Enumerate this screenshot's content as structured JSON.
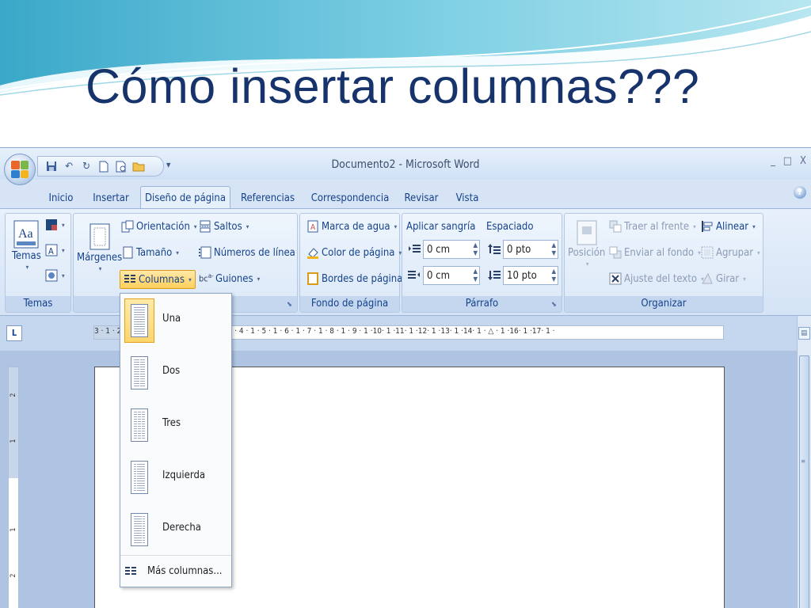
{
  "slide": {
    "title": "Cómo insertar columnas???"
  },
  "window": {
    "title": "Documento2 - Microsoft Word",
    "controls": [
      "_",
      "□",
      "X"
    ],
    "qat_icons": [
      "save-icon",
      "undo-icon",
      "redo-icon",
      "new-document-icon",
      "print-preview-icon",
      "open-icon"
    ]
  },
  "tabs": [
    "Inicio",
    "Insertar",
    "Diseño de página",
    "Referencias",
    "Correspondencia",
    "Revisar",
    "Vista"
  ],
  "active_tab": "Diseño de página",
  "ribbon": {
    "temas": {
      "label": "Temas",
      "button": "Temas"
    },
    "configurar": {
      "orientacion": "Orientación",
      "tamano": "Tamaño",
      "columnas": "Columnas",
      "margenes": "Márgenes",
      "saltos": "Saltos",
      "numeros": "Números de línea",
      "guiones": "Guiones"
    },
    "fondo": {
      "label": "Fondo de página",
      "marca": "Marca de agua",
      "color": "Color de página",
      "bordes": "Bordes de página"
    },
    "parrafo": {
      "label": "Párrafo",
      "sangria_title": "Aplicar sangría",
      "espaciado_title": "Espaciado",
      "sangria_izq": "0 cm",
      "sangria_der": "0 cm",
      "espacio_antes": "0 pto",
      "espacio_despues": "10 pto"
    },
    "organizar": {
      "label": "Organizar",
      "posicion": "Posición",
      "traer": "Traer al frente",
      "enviar": "Enviar al fondo",
      "ajuste": "Ajuste del texto",
      "alinear": "Alinear",
      "agrupar": "Agrupar",
      "girar": "Girar"
    }
  },
  "ruler": {
    "tab_selector": "L",
    "numbers": "3 · 1 · 2 · 1 · 1 · 1 · · · 1 · 1 · 2 · 1 · 3 · 1 · 4 · 1 · 5 · 1 · 6 · 1 · 7 · 1 · 8 · 1 · 9 · 1 ·10· 1 ·11· 1 ·12· 1 ·13· 1 ·14· 1 · △ · 1 ·16· 1 ·17· 1 ·",
    "vertical": [
      "2",
      "1",
      "1",
      "2"
    ]
  },
  "columns_menu": {
    "items": [
      "Una",
      "Dos",
      "Tres",
      "Izquierda",
      "Derecha"
    ],
    "selected": "Una",
    "more": "Más columnas..."
  },
  "colors": {
    "title": "#17336b",
    "ribbon_text": "#15428b",
    "highlight": "#ffd56b"
  }
}
